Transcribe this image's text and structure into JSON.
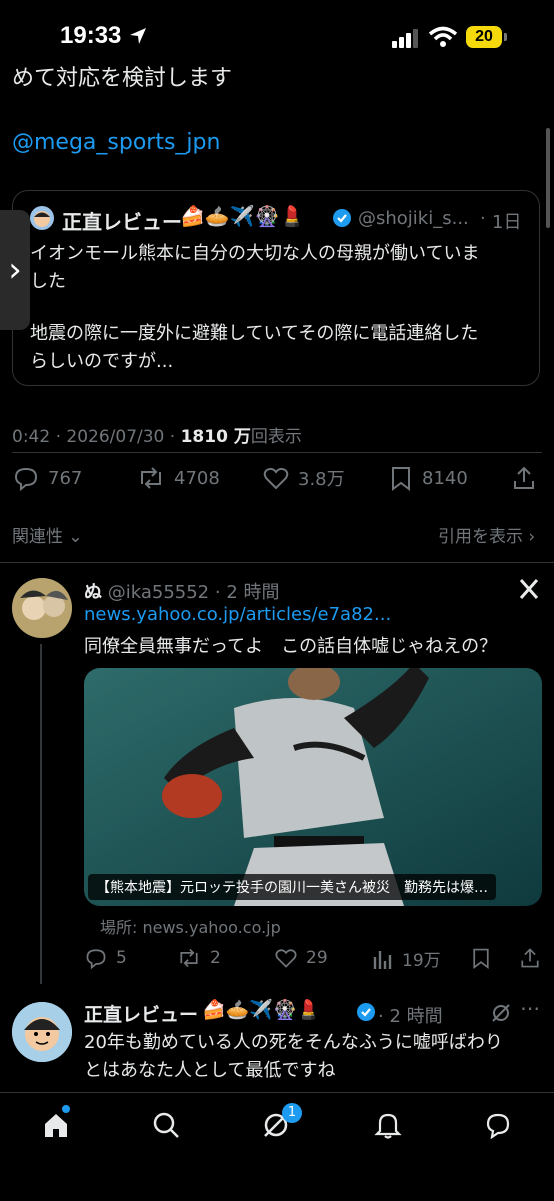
{
  "status": {
    "time": "19:33",
    "battery": "20"
  },
  "tweet": {
    "text_fragment": "めて対応を検討します",
    "mention": "@mega_sports_jpn",
    "quoted": {
      "author": "正直レビュー",
      "author_emoji": "🍰🥧✈️🎡💄",
      "handle": "@shojiki_s...",
      "time": "1日",
      "line1": "イオンモール熊本に自分の大切な人の母親が働いていま",
      "line2": "した",
      "line3": "地震の際に一度外に避難していてその際に電話連絡した",
      "line4": "らしいのですが..."
    },
    "meta": {
      "timestamp": "0:42 · 2026/07/30 · ",
      "views_count": "1810 万",
      "views_label": "回表示"
    },
    "actions": {
      "replies": "767",
      "reposts": "4708",
      "likes": "3.8万",
      "bookmarks": "8140"
    },
    "sort_label": "関連性",
    "view_quotes_label": "引用を表示"
  },
  "reply1": {
    "name": "ぬ",
    "handle": "@ika55552",
    "time": "2 時間",
    "link": "news.yahoo.co.jp/articles/e7a82...",
    "text": "同僚全員無事だってよ　この話自体嘘じゃねえの？",
    "card_caption": "【熊本地震】元ロッテ投手の園川一美さん被災　勤務先は爆…",
    "card_source": "場所: news.yahoo.co.jp",
    "actions": {
      "replies": "5",
      "reposts": "2",
      "likes": "29",
      "views": "19万"
    }
  },
  "reply2": {
    "name": "正直レビュー",
    "emoji": "🍰🥧✈️🎡💄",
    "time": "2 時間",
    "line1": "20年も勤めている人の死をそんなふうに嘘呼ばわり",
    "line2": "とはあなた人として最低ですね"
  },
  "nav": {
    "messages_badge": "1"
  },
  "colors": {
    "accent": "#1d9bf0",
    "muted": "#71767b",
    "border": "#2f3336"
  }
}
